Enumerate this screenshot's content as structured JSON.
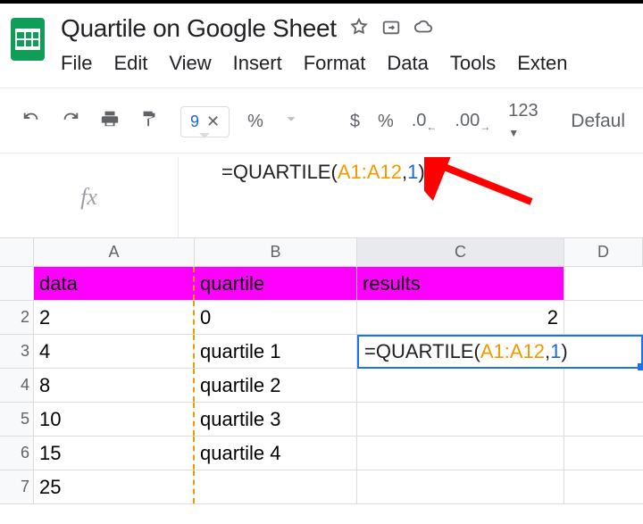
{
  "title": "Quartile on Google Sheet",
  "menu": [
    "File",
    "Edit",
    "View",
    "Insert",
    "Format",
    "Data",
    "Tools",
    "Exten"
  ],
  "toolbar": {
    "paste_badge": "9",
    "currency": "$",
    "percent": "%",
    "dec_dec": ".0",
    "inc_dec": ".00",
    "num_fmt": "123",
    "font": "Defaul"
  },
  "fx": {
    "label": "fx",
    "eq": "=",
    "fn": "QUARTILE",
    "open": "(",
    "range": "A1:A12",
    "comma": ",",
    "arg": "1",
    "close": ")"
  },
  "columns": [
    "A",
    "B",
    "C",
    "D"
  ],
  "row_heads": [
    "",
    "2",
    "3",
    "4",
    "5",
    "6",
    "7"
  ],
  "cells": {
    "r1": {
      "a": "data",
      "b": "quartile",
      "c": "results"
    },
    "r2": {
      "a": "2",
      "b": "0",
      "c": "2"
    },
    "r3": {
      "a": "4",
      "b": "quartile 1"
    },
    "r4": {
      "a": "8",
      "b": "quartile 2"
    },
    "r5": {
      "a": "10",
      "b": "quartile 3"
    },
    "r6": {
      "a": "15",
      "b": "quartile 4"
    },
    "r7": {
      "a": "25",
      "b": ""
    }
  },
  "active_formula": {
    "eq": "=",
    "fn": "QUARTILE",
    "open": "(",
    "range": "A1:A12",
    "comma": ",",
    "arg": "1",
    "close": ")"
  }
}
